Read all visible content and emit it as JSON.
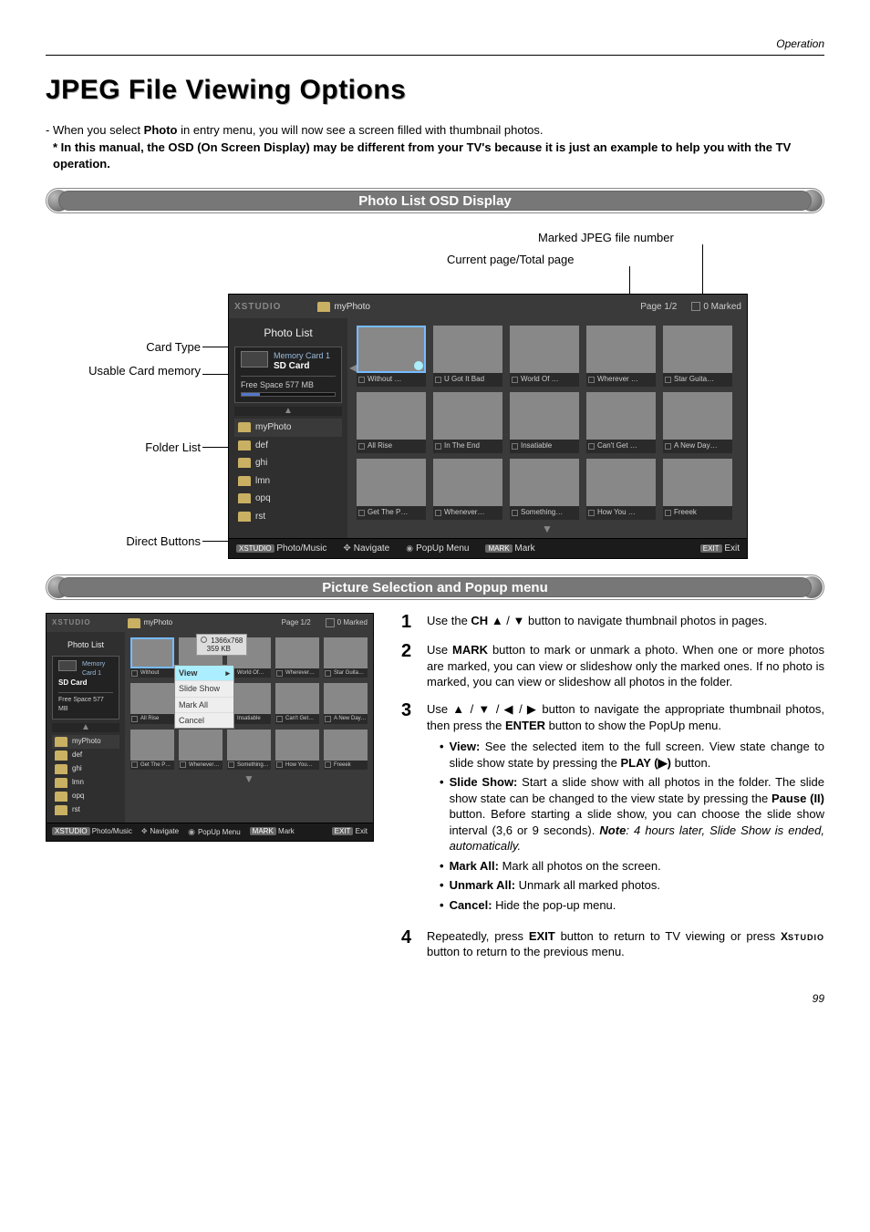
{
  "header_label": "Operation",
  "title": "JPEG File Viewing Options",
  "intro": {
    "line1_pre": "-  When you select ",
    "line1_bold": "Photo",
    "line1_post": " in entry menu, you will now see a screen filled with thumbnail photos.",
    "line2": "* In this manual, the OSD (On Screen Display) may be different from your TV's because it is just an example to help you with the TV operation."
  },
  "section1_title": "Photo List OSD Display",
  "annotations": {
    "marked": "Marked JPEG file number",
    "page": "Current page/Total page",
    "card_type": "Card Type",
    "usable": "Usable Card memory",
    "folder_list": "Folder List",
    "direct": "Direct Buttons"
  },
  "osd": {
    "logo": "XSTUDIO",
    "path": "myPhoto",
    "page": "Page  1/2",
    "marked": "0 Marked",
    "sidebar_title": "Photo List",
    "card_line1": "Memory Card 1",
    "card_line2": "SD Card",
    "free_space": "Free Space 577 MB",
    "folders": [
      "myPhoto",
      "def",
      "ghi",
      "lmn",
      "opq",
      "rst"
    ],
    "thumbs_row1": [
      "Without …",
      "U Got It Bad",
      "World Of …",
      "Wherever …",
      "Star Guita…"
    ],
    "thumbs_row2": [
      "All Rise",
      "In The End",
      "Insatiable",
      "Can't Get …",
      "A New Day…"
    ],
    "thumbs_row3": [
      "Get The P…",
      "Whenever…",
      "Something…",
      "How You …",
      "Freeek"
    ],
    "thumbs_row1b": [
      "Without",
      "World Of…",
      "Wherever…",
      "Star Guita…"
    ],
    "thumbs_row2b": [
      "All Rise",
      "Insatiable",
      "Can't Get…",
      "A New Day…"
    ],
    "thumbs_row3b": [
      "Get The P…",
      "Whenever…",
      "Something…",
      "How You…",
      "Freeek"
    ],
    "footer": {
      "b1": "Photo/Music",
      "b2": "Navigate",
      "b3": "PopUp Menu",
      "b4": "Mark",
      "b5": "Exit",
      "btn1": "XSTUDIO",
      "btn4": "MARK",
      "btn5": "EXIT"
    },
    "tooltip": {
      "res": "1366x768",
      "size": "359 KB"
    },
    "popup": [
      "View",
      "Slide Show",
      "Mark All",
      "Cancel"
    ]
  },
  "section2_title": "Picture Selection and Popup menu",
  "steps": {
    "s1": {
      "pre": "Use the ",
      "b1": "CH",
      "mid": " ▲ / ▼ button to navigate thumbnail photos in pages."
    },
    "s2": {
      "pre": "Use ",
      "b1": "MARK",
      "post": " button to mark or unmark a photo. When one or more photos are marked, you can view or slideshow only the marked ones. If no photo is marked, you can view or slideshow all photos in the folder."
    },
    "s3": {
      "pre": "Use ▲ / ▼ / ◀ / ▶ button to navigate the appropriate thumbnail photos, then press the ",
      "b1": "ENTER",
      "post": " button to show the PopUp menu."
    },
    "bullets": {
      "view": {
        "t": "View:",
        "d": " See the selected item to the full screen. View state change to slide show state by pressing the ",
        "b": "PLAY (▶)",
        "post": " button."
      },
      "slide": {
        "t": "Slide Show:",
        "d": " Start a slide show with all photos in the folder. The slide show state can be changed to the view state by pressing the ",
        "b": "Pause (II)",
        "d2": " button. Before starting a slide show, you can choose the slide show interval (3,6 or 9 seconds). ",
        "note_i": "Note",
        "note": ": 4 hours later, Slide Show is ended, automatically."
      },
      "markall": {
        "t": "Mark All:",
        "d": " Mark all photos on the screen."
      },
      "unmarkall": {
        "t": "Unmark All:",
        "d": " Unmark all marked photos."
      },
      "cancel": {
        "t": "Cancel:",
        "d": " Hide the pop-up menu."
      }
    },
    "s4": {
      "pre": "Repeatedly, press  ",
      "b1": "EXIT",
      "mid": " button to return to TV viewing or press ",
      "logo": "XSTUDIO",
      "post": " button to return to the previous menu."
    }
  },
  "page_num": "99"
}
